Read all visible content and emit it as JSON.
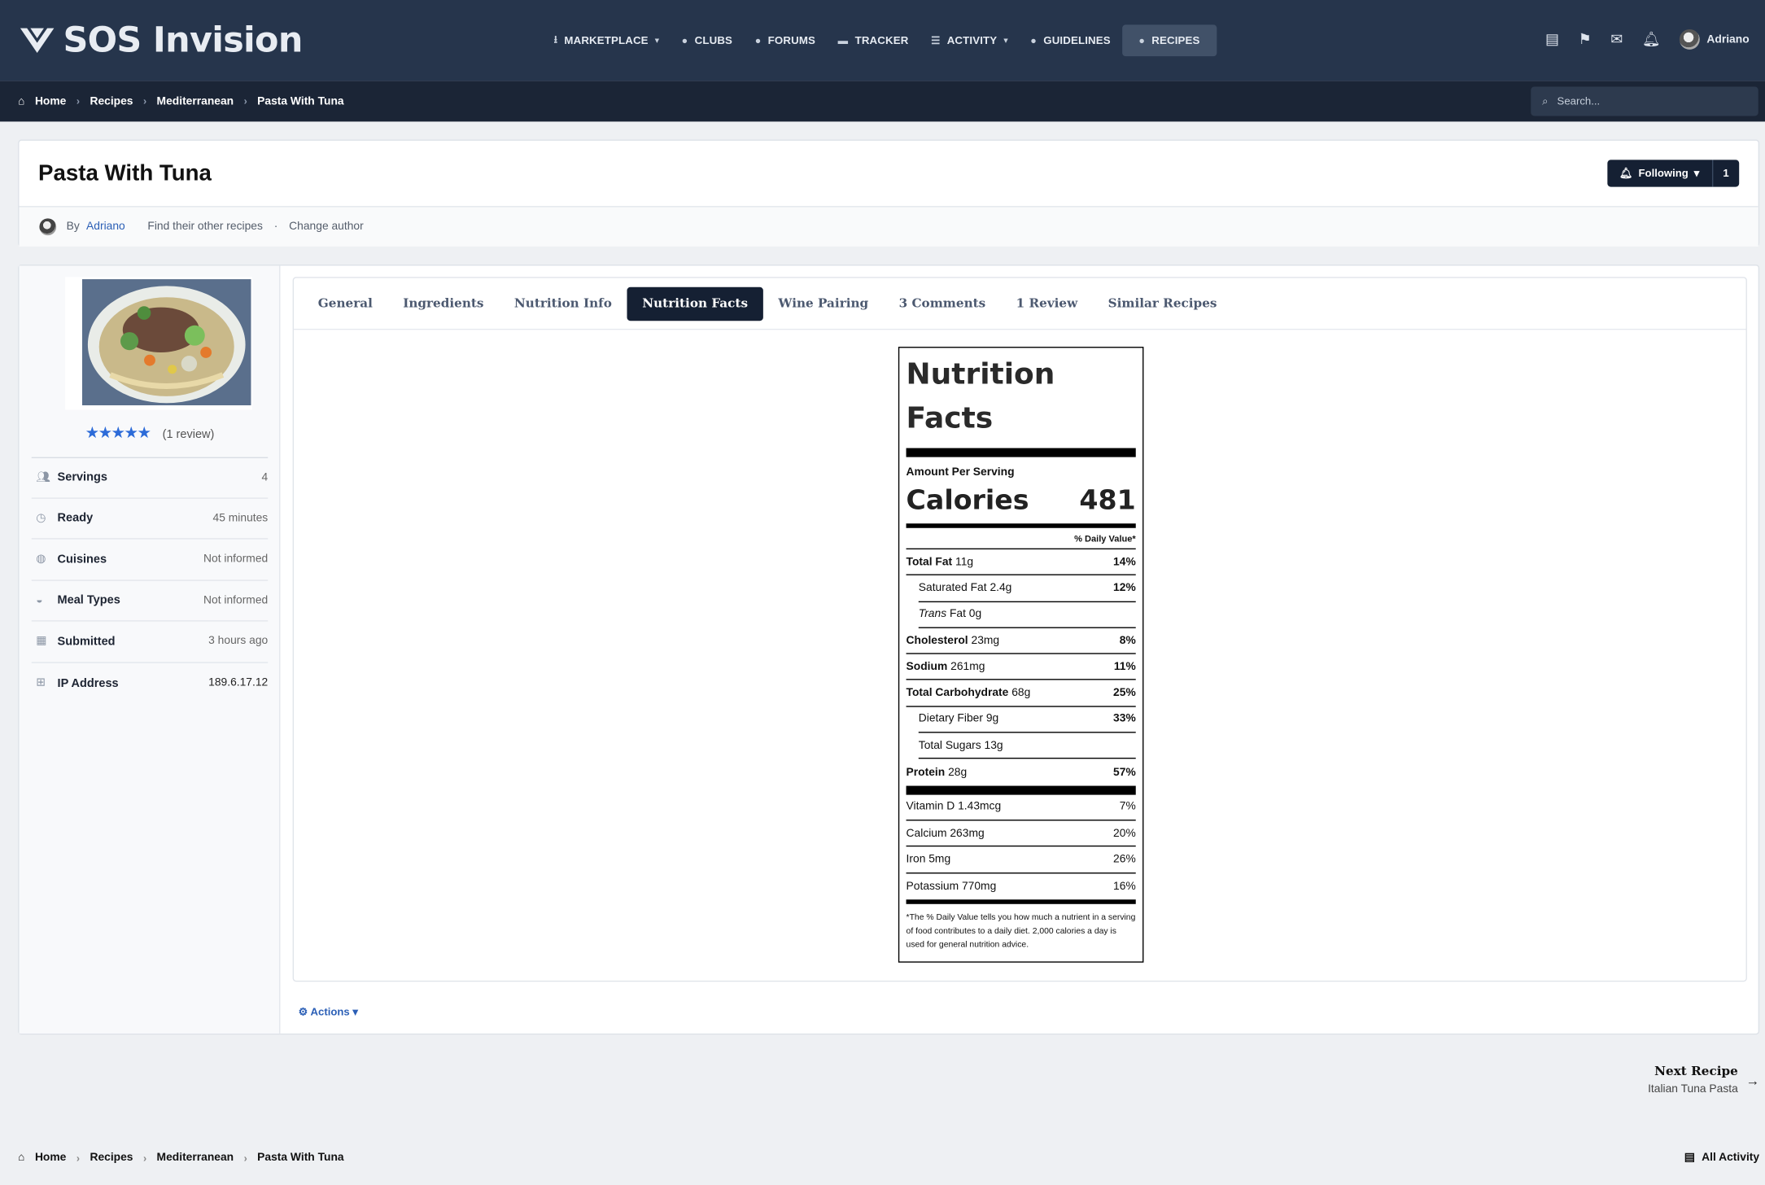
{
  "brand": {
    "name": "SOS Invision"
  },
  "nav": [
    {
      "label": "MARKETPLACE",
      "icon": "download-icon",
      "caret": true
    },
    {
      "label": "CLUBS",
      "icon": "info-circle-icon",
      "caret": false
    },
    {
      "label": "FORUMS",
      "icon": "chat-bubble-icon",
      "caret": false
    },
    {
      "label": "TRACKER",
      "icon": "folder-icon",
      "caret": false
    },
    {
      "label": "ACTIVITY",
      "icon": "list-icon",
      "caret": true
    },
    {
      "label": "GUIDELINES",
      "icon": "check-circle-icon",
      "caret": false
    },
    {
      "label": "RECIPES",
      "icon": "circle-icon",
      "caret": false,
      "active": true
    }
  ],
  "user": {
    "name": "Adriano"
  },
  "breadcrumb": {
    "home": "Home",
    "recipes": "Recipes",
    "category": "Mediterranean",
    "current": "Pasta With Tuna"
  },
  "search": {
    "placeholder": "Search..."
  },
  "recipe": {
    "title": "Pasta With Tuna",
    "following_label": "Following",
    "following_count": "1",
    "by_label": "By",
    "author": "Adriano",
    "find_other": "Find their other recipes",
    "dot": "·",
    "change_author": "Change author"
  },
  "rating": {
    "stars": 5,
    "text": "(1 review)"
  },
  "facts": [
    {
      "icon": "users-icon",
      "label": "Servings",
      "value": "4"
    },
    {
      "icon": "clock-icon",
      "label": "Ready",
      "value": "45 minutes"
    },
    {
      "icon": "globe-icon",
      "label": "Cuisines",
      "value": "Not informed"
    },
    {
      "icon": "bowl-icon",
      "label": "Meal Types",
      "value": "Not informed"
    },
    {
      "icon": "calendar-icon",
      "label": "Submitted",
      "value": "3 hours ago"
    },
    {
      "icon": "network-icon",
      "label": "IP Address",
      "value": "189.6.17.12"
    }
  ],
  "tabs": [
    {
      "label": "General"
    },
    {
      "label": "Ingredients"
    },
    {
      "label": "Nutrition Info"
    },
    {
      "label": "Nutrition Facts",
      "active": true
    },
    {
      "label": "Wine Pairing"
    },
    {
      "label": "3 Comments"
    },
    {
      "label": "1 Review"
    },
    {
      "label": "Similar Recipes"
    }
  ],
  "nutrition": {
    "title_line1": "Nutrition",
    "title_line2": "Facts",
    "amount_per_serving": "Amount Per Serving",
    "calories_label": "Calories",
    "calories_value": "481",
    "daily_value_header": "% Daily Value*",
    "rows": [
      {
        "label": "Total Fat",
        "amount": "11g",
        "pct": "14%",
        "bold": true,
        "indent": false,
        "italic_prefix": ""
      },
      {
        "label": "Saturated Fat",
        "amount": "2.4g",
        "pct": "12%",
        "bold": false,
        "indent": true,
        "italic_prefix": ""
      },
      {
        "label": "Fat",
        "amount": "0g",
        "pct": "",
        "bold": false,
        "indent": true,
        "italic_prefix": "Trans"
      },
      {
        "label": "Cholesterol",
        "amount": "23mg",
        "pct": "8%",
        "bold": true,
        "indent": false,
        "italic_prefix": ""
      },
      {
        "label": "Sodium",
        "amount": "261mg",
        "pct": "11%",
        "bold": true,
        "indent": false,
        "italic_prefix": ""
      },
      {
        "label": "Total Carbohydrate",
        "amount": "68g",
        "pct": "25%",
        "bold": true,
        "indent": false,
        "italic_prefix": ""
      },
      {
        "label": "Dietary Fiber",
        "amount": "9g",
        "pct": "33%",
        "bold": false,
        "indent": true,
        "italic_prefix": ""
      },
      {
        "label": "Total Sugars",
        "amount": "13g",
        "pct": "",
        "bold": false,
        "indent": true,
        "italic_prefix": ""
      },
      {
        "label": "Protein",
        "amount": "28g",
        "pct": "57%",
        "bold": true,
        "indent": false,
        "italic_prefix": ""
      }
    ],
    "vitamins": [
      {
        "label": "Vitamin D 1.43mcg",
        "pct": "7%"
      },
      {
        "label": "Calcium 263mg",
        "pct": "20%"
      },
      {
        "label": "Iron 5mg",
        "pct": "26%"
      },
      {
        "label": "Potassium 770mg",
        "pct": "16%"
      }
    ],
    "footnote": "*The % Daily Value tells you how much a nutrient in a serving of food contributes to a daily diet. 2,000 calories a day is used for general nutrition advice."
  },
  "actions": {
    "label": "Actions"
  },
  "next_recipe": {
    "heading": "Next Recipe",
    "title": "Italian Tuna Pasta"
  },
  "footer": {
    "all_activity": "All Activity"
  },
  "colors": {
    "topbar": "#26354c",
    "crumbbar": "#1b2536",
    "accent": "#152033",
    "link": "#2b5fb6",
    "star": "#2c6bd8"
  }
}
